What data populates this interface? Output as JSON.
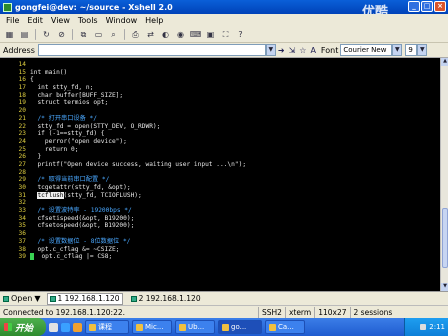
{
  "window": {
    "title": "gongfei@dev: ~/source - Xshell 2.0",
    "watermark": "优酷"
  },
  "menu": [
    "File",
    "Edit",
    "View",
    "Tools",
    "Window",
    "Help"
  ],
  "addressbar": {
    "label": "Address",
    "value": "",
    "font_label": "Font",
    "font_value": "Courier New",
    "size_value": "9"
  },
  "terminal_lines": [
    {
      "n": "14",
      "t": ""
    },
    {
      "n": "15",
      "t": "int main()"
    },
    {
      "n": "16",
      "t": "{"
    },
    {
      "n": "17",
      "t": "  int stty_fd, n;"
    },
    {
      "n": "18",
      "t": "  char buffer[BUFF_SIZE];"
    },
    {
      "n": "19",
      "t": "  struct termios opt;"
    },
    {
      "n": "20",
      "t": ""
    },
    {
      "n": "21",
      "t": "  /* 打开串口设备 */",
      "c": true
    },
    {
      "n": "22",
      "t": "  stty_fd = open(STTY_DEV, O_RDWR);"
    },
    {
      "n": "23",
      "t": "  if (-1==stty_fd) {"
    },
    {
      "n": "24",
      "t": "    perror(\"open device\");"
    },
    {
      "n": "25",
      "t": "    return 0;"
    },
    {
      "n": "26",
      "t": "  }"
    },
    {
      "n": "27",
      "t": "  printf(\"Open device success, waiting user input ...\\n\");"
    },
    {
      "n": "28",
      "t": ""
    },
    {
      "n": "29",
      "t": "  /* 取得当前串口配置 */",
      "c": true
    },
    {
      "n": "30",
      "t": "  tcgetattr(stty_fd, &opt);"
    },
    {
      "n": "31",
      "t": "  tcflush(stty_fd, TCIOFLUSH);",
      "h": "tcflush"
    },
    {
      "n": "32",
      "t": ""
    },
    {
      "n": "33",
      "t": "  /* 设置波特率 - 19200bps */",
      "c": true
    },
    {
      "n": "34",
      "t": "  cfsetispeed(&opt, B19200);"
    },
    {
      "n": "35",
      "t": "  cfsetospeed(&opt, B19200);"
    },
    {
      "n": "36",
      "t": ""
    },
    {
      "n": "37",
      "t": "  /* 设置数据位 - 8位数据位 */",
      "c": true
    },
    {
      "n": "38",
      "t": "  opt.c_cflag &= ~CSIZE;"
    },
    {
      "n": "39",
      "t": "  opt.c_cflag |= CS8;",
      "cursor": true
    }
  ],
  "tabs": {
    "open_label": "Open",
    "items": [
      "1 192.168.1.120",
      "2 192.168.1.120"
    ]
  },
  "status": {
    "connection": "Connected to 192.168.1.120:22.",
    "protocol": "SSH2",
    "term": "xterm",
    "size": "110x27",
    "sessions": "2 sessions"
  },
  "taskbar": {
    "start": "开始",
    "tasks": [
      "课程",
      "Mic...",
      "Ub...",
      "go...",
      "Ca..."
    ],
    "clock": "2:11"
  },
  "colors": {
    "titlebar": "#0a5fd8",
    "terminal_bg": "#000000",
    "line_numbers": "#e0d040",
    "comments": "#4aa8ff",
    "cursor": "#39d353"
  }
}
